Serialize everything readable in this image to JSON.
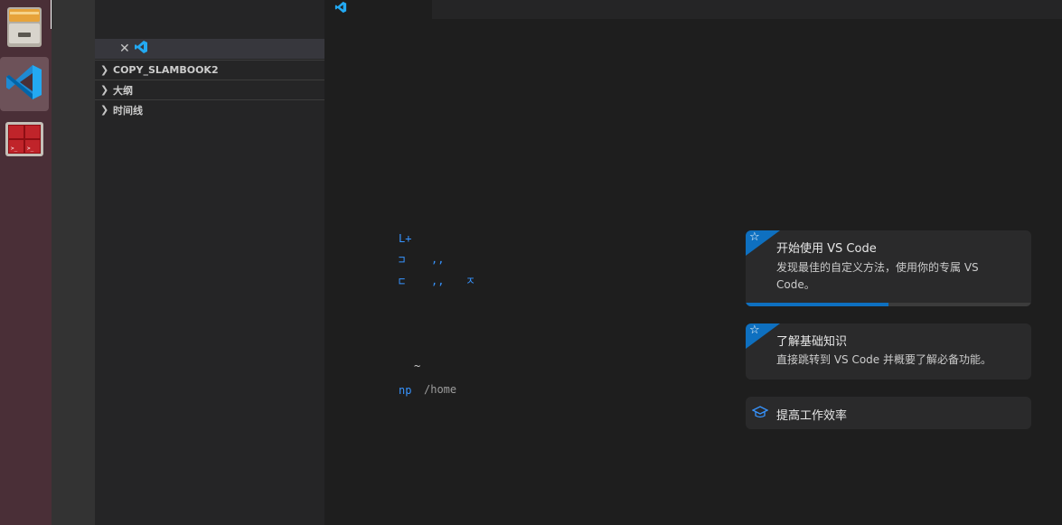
{
  "dock": {
    "items": [
      {
        "name": "files-app",
        "icon": "file-cabinet-icon"
      },
      {
        "name": "vscode-app",
        "icon": "vscode-icon",
        "active": true
      },
      {
        "name": "terminal-app",
        "icon": "terminal-icon"
      }
    ]
  },
  "sidebar": {
    "sections": [
      {
        "label": "COPY_SLAMBOOK2"
      },
      {
        "label": "大纲"
      },
      {
        "label": "时间线"
      }
    ]
  },
  "editor": {
    "start_links": [
      "L+",
      "⊐",
      "⊏",
      ",,",
      ",,",
      "ㅈ"
    ],
    "recent": {
      "item": "~",
      "path": "/home",
      "prefix": "np"
    }
  },
  "walkthroughs": [
    {
      "title": "开始使用 VS Code",
      "desc": "发现最佳的自定义方法，使用你的专属 VS Code。",
      "progress": 0.5,
      "icon": "star-icon"
    },
    {
      "title": "了解基础知识",
      "desc": "直接跳转到 VS Code 并概要了解必备功能。",
      "icon": "star-icon"
    },
    {
      "title": "提高工作效率",
      "icon": "mortarboard-icon"
    }
  ],
  "colors": {
    "accent": "#0e70c0",
    "vscode_blue": "#23a9f2",
    "dock_bg": "#4a2f37"
  }
}
